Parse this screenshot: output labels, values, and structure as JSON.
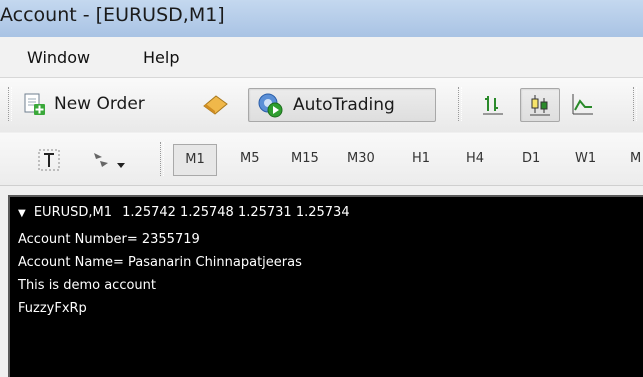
{
  "window": {
    "title": "Account - [EURUSD,M1]"
  },
  "menu": {
    "items": [
      "Window",
      "Help"
    ]
  },
  "toolbar": {
    "new_order_label": "New Order",
    "autotrading_label": "AutoTrading"
  },
  "timeframes": {
    "items": [
      "M1",
      "M5",
      "M15",
      "M30",
      "H1",
      "H4",
      "D1",
      "W1",
      "M"
    ],
    "active": "M1"
  },
  "chart": {
    "symbol_header": "EURUSD,M1",
    "ohlc": "1.25742 1.25748 1.25731 1.25734",
    "lines": [
      "Account Number= 2355719",
      "Account Name= Pasanarin Chinnapatjeeras",
      "This is demo account",
      "FuzzyFxRp"
    ]
  },
  "colors": {
    "titlebar": "#b9d0ec",
    "chart_background": "#000000",
    "chart_text": "#ffffff",
    "autotrading_green": "#2f9e2f"
  }
}
